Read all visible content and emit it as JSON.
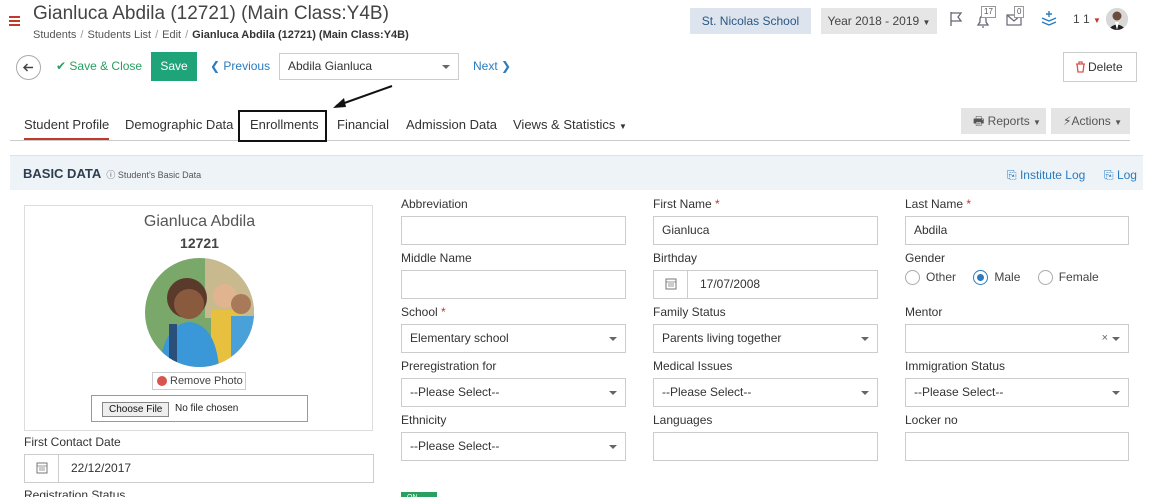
{
  "header": {
    "title": "Gianluca Abdila (12721) (Main Class:Y4B)",
    "breadcrumb": [
      "Students",
      "Students List",
      "Edit"
    ],
    "breadcrumb_current": "Gianluca Abdila (12721) (Main Class:Y4B)",
    "school": "St. Nicolas School",
    "year": "Year 2018 - 2019",
    "messages_count": "17",
    "mail_count": "0",
    "user_label": "1 1"
  },
  "toolbar": {
    "save_close": "Save & Close",
    "save": "Save",
    "previous": "Previous",
    "student_selected": "Abdila Gianluca",
    "next": "Next",
    "delete": "Delete"
  },
  "tabs": {
    "student_profile": "Student Profile",
    "demographic": "Demographic Data",
    "enrollments": "Enrollments",
    "financial": "Financial",
    "admission": "Admission Data",
    "views": "Views & Statistics",
    "reports": "Reports",
    "actions": "Actions"
  },
  "panel": {
    "title": "BASIC DATA",
    "subtitle": "Student's Basic Data",
    "institute_log": "Institute Log",
    "log": "Log"
  },
  "photo": {
    "name": "Gianluca Abdila",
    "id": "12721",
    "remove": "Remove Photo",
    "choose_file": "Choose File",
    "no_file": "No file chosen"
  },
  "fields": {
    "first_contact_label": "First Contact Date",
    "first_contact_value": "22/12/2017",
    "registration_status_label": "Registration Status",
    "abbreviation_label": "Abbreviation",
    "abbreviation_value": "",
    "first_name_label": "First Name",
    "first_name_value": "Gianluca",
    "last_name_label": "Last Name",
    "last_name_value": "Abdila",
    "middle_name_label": "Middle Name",
    "middle_name_value": "",
    "birthday_label": "Birthday",
    "birthday_value": "17/07/2008",
    "gender_label": "Gender",
    "gender_options": [
      "Other",
      "Male",
      "Female"
    ],
    "gender_selected": "Male",
    "school_label": "School",
    "school_value": "Elementary school",
    "family_status_label": "Family Status",
    "family_status_value": "Parents living together",
    "mentor_label": "Mentor",
    "mentor_value": "",
    "preregistration_label": "Preregistration for",
    "preregistration_value": "--Please Select--",
    "medical_label": "Medical Issues",
    "medical_value": "--Please Select--",
    "immigration_label": "Immigration Status",
    "immigration_value": "--Please Select--",
    "ethnicity_label": "Ethnicity",
    "ethnicity_value": "--Please Select--",
    "languages_label": "Languages",
    "languages_value": "",
    "locker_label": "Locker no",
    "locker_value": ""
  },
  "colors": {
    "accent_red": "#c0392b",
    "save_green": "#1fa47a",
    "link_blue": "#2a7bbf"
  }
}
